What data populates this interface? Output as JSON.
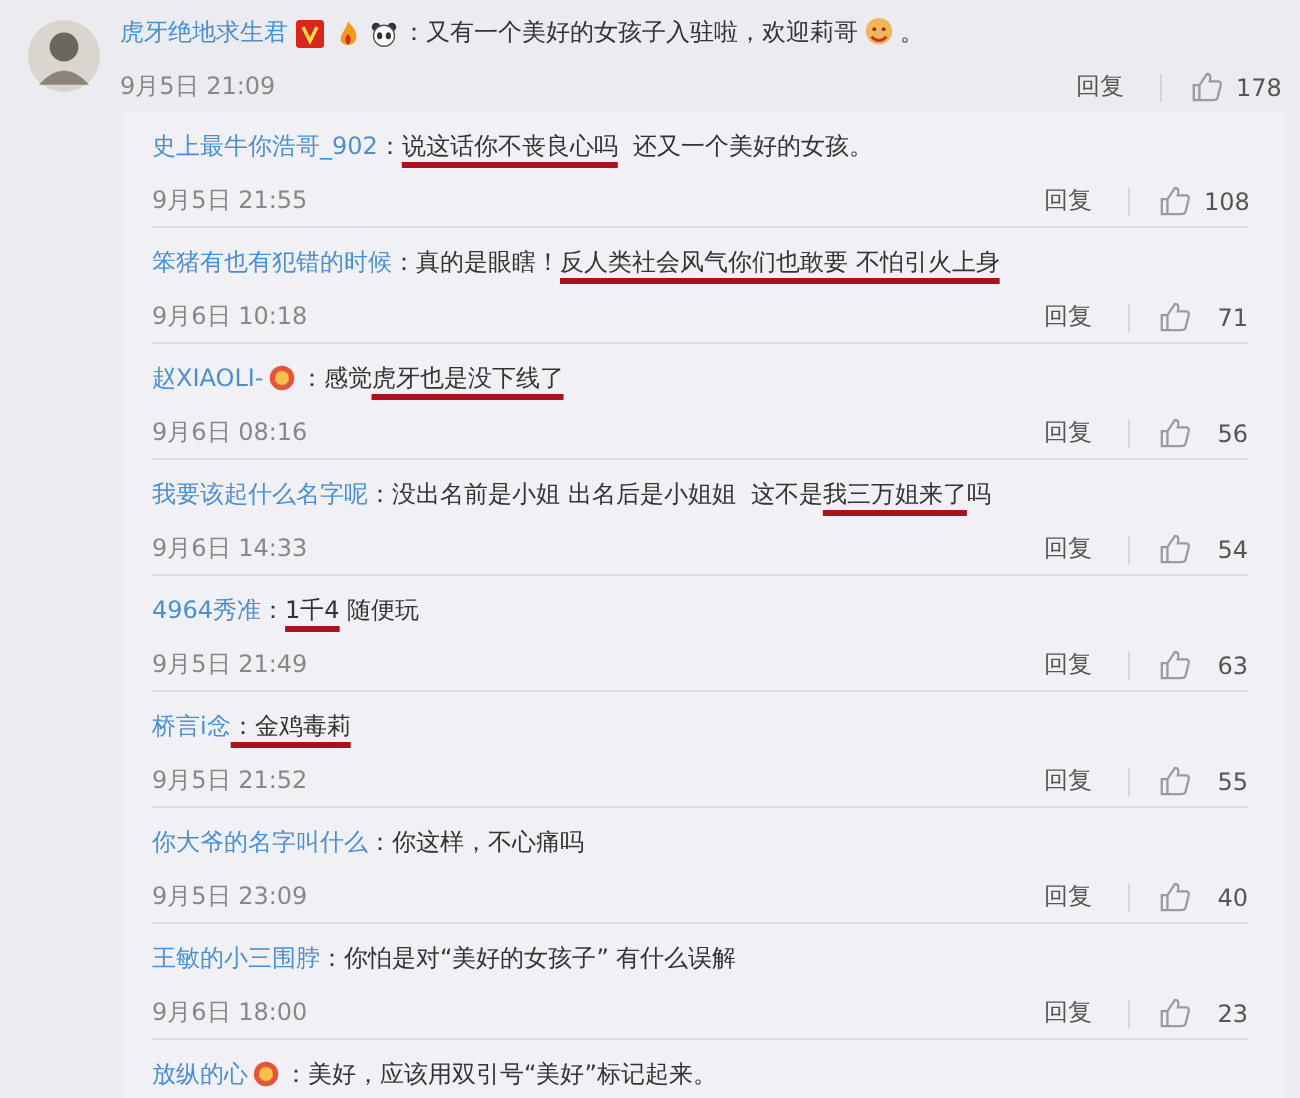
{
  "comment": {
    "author": "虎牙绝地求生君",
    "verified": true,
    "badges": [
      {
        "kind": "flame"
      },
      {
        "kind": "panda"
      }
    ],
    "segments": [
      {
        "kind": "text",
        "text": "：又有一个美好的女孩子入驻啦，欢迎莉哥",
        "underlined": false
      },
      {
        "kind": "emoji"
      },
      {
        "kind": "text",
        "text": "。",
        "underlined": false
      }
    ],
    "date": "9月5日 21:09",
    "reply_label": "回复",
    "likes": "178"
  },
  "replies": [
    {
      "author": "史上最牛你浩哥_902",
      "segments": [
        {
          "kind": "text",
          "text": "：",
          "underlined": false
        },
        {
          "kind": "text",
          "text": "说这话你不丧良心吗",
          "underlined": true
        },
        {
          "kind": "text",
          "text": "  还又一个美好的女孩。",
          "underlined": false
        }
      ],
      "date": "9月5日 21:55",
      "reply_label": "回复",
      "likes": "108"
    },
    {
      "author": "笨猪有也有犯错的时候",
      "segments": [
        {
          "kind": "text",
          "text": "：真的是眼瞎！",
          "underlined": false
        },
        {
          "kind": "text",
          "text": "反人类社会风气你们也敢要 不怕引火上身",
          "underlined": true
        }
      ],
      "date": "9月6日 10:18",
      "reply_label": "回复",
      "likes": "71"
    },
    {
      "author": "赵XIAOLI-",
      "badge": true,
      "segments": [
        {
          "kind": "text",
          "text": "：感觉",
          "underlined": false
        },
        {
          "kind": "text",
          "text": "虎牙也是没下线了",
          "underlined": true
        }
      ],
      "date": "9月6日 08:16",
      "reply_label": "回复",
      "likes": "56"
    },
    {
      "author": "我要该起什么名字呢",
      "segments": [
        {
          "kind": "text",
          "text": "：没出名前是小姐 出名后是小姐姐  这不是",
          "underlined": false
        },
        {
          "kind": "text",
          "text": "我三万姐来了",
          "underlined": true
        },
        {
          "kind": "text",
          "text": "吗",
          "underlined": false
        }
      ],
      "date": "9月6日 14:33",
      "reply_label": "回复",
      "likes": "54"
    },
    {
      "author": "4964秀准",
      "segments": [
        {
          "kind": "text",
          "text": "：",
          "underlined": false
        },
        {
          "kind": "text",
          "text": "1千4",
          "underlined": true
        },
        {
          "kind": "text",
          "text": " 随便玩",
          "underlined": false
        }
      ],
      "date": "9月5日 21:49",
      "reply_label": "回复",
      "likes": "63"
    },
    {
      "author": "桥言i念",
      "segments": [
        {
          "kind": "text",
          "text": "：金鸡毒莉",
          "underlined": true
        }
      ],
      "date": "9月5日 21:52",
      "reply_label": "回复",
      "likes": "55"
    },
    {
      "author": "你大爷的名字叫什么",
      "segments": [
        {
          "kind": "text",
          "text": "：你这样，不心痛吗",
          "underlined": false
        }
      ],
      "date": "9月5日 23:09",
      "reply_label": "回复",
      "likes": "40"
    },
    {
      "author": "王敏的小三围脖",
      "segments": [
        {
          "kind": "text",
          "text": "：你怕是对“美好的女孩子” 有什么误解",
          "underlined": false
        }
      ],
      "date": "9月6日 18:00",
      "reply_label": "回复",
      "likes": "23"
    },
    {
      "author": "放纵的心",
      "badge": true,
      "segments": [
        {
          "kind": "text",
          "text": "：美好，应该用双引号“美好”标记起来。",
          "underlined": false
        }
      ]
    }
  ]
}
